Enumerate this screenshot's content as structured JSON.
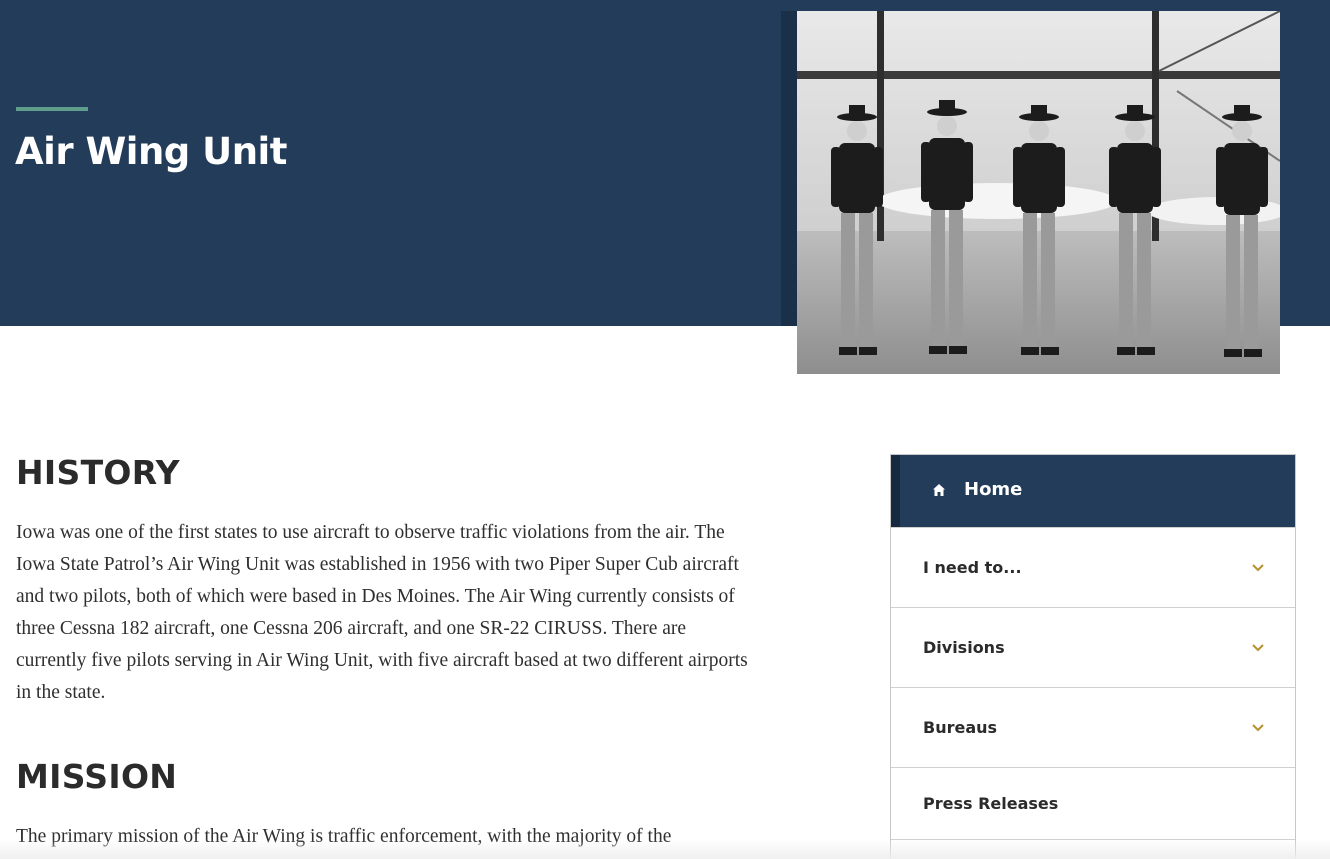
{
  "hero": {
    "title": "Air Wing Unit",
    "background_color": "#233c5a",
    "accent_color": "#5f9e8c",
    "image_description_icon": "troopers-photo"
  },
  "sections": {
    "history": {
      "heading": "HISTORY",
      "body": "Iowa was one of the first states to use aircraft to observe traffic violations from the air. The Iowa State Patrol’s Air Wing Unit was established in 1956 with two Piper Super Cub aircraft and two pilots, both of which were based in Des Moines. The Air Wing currently consists of three Cessna 182 aircraft, one Cessna 206 aircraft, and one SR-22 CIRUSS. There are currently five pilots serving in Air Wing Unit, with five aircraft based at two different airports in the state."
    },
    "mission": {
      "heading": "MISSION",
      "body": "The primary mission of the Air Wing is traffic enforcement, with the majority of the"
    }
  },
  "sidenav": {
    "home": {
      "label": "Home",
      "icon": "home-icon"
    },
    "items": [
      {
        "label": "I need to...",
        "icon": "chevron-down-icon"
      },
      {
        "label": "Divisions",
        "icon": "chevron-down-icon"
      },
      {
        "label": "Bureaus",
        "icon": "chevron-down-icon"
      },
      {
        "label": "Press Releases"
      }
    ],
    "chevron_color": "#b8912e"
  }
}
